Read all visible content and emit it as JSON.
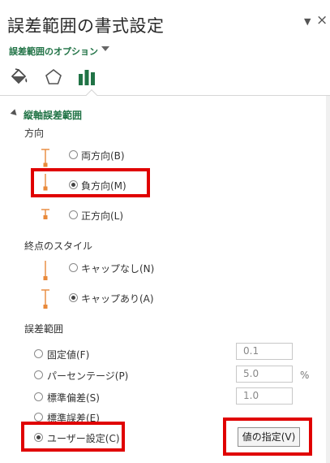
{
  "pane": {
    "title": "誤差範囲の書式設定",
    "pin_icon": "▼",
    "close_icon": "×",
    "options_label": "誤差範囲のオプション"
  },
  "tabs": [
    {
      "name": "fill-line",
      "icon": "paint-bucket-icon"
    },
    {
      "name": "effects",
      "icon": "pentagon-icon"
    },
    {
      "name": "options",
      "icon": "bar-chart-icon",
      "selected": true
    }
  ],
  "section": {
    "label": "縦軸誤差範囲"
  },
  "direction": {
    "label": "方向",
    "options": [
      {
        "label": "両方向(B)",
        "checked": false
      },
      {
        "label": "負方向(M)",
        "checked": true
      },
      {
        "label": "正方向(L)",
        "checked": false
      }
    ]
  },
  "end_style": {
    "label": "終点のスタイル",
    "options": [
      {
        "label": "キャップなし(N)",
        "checked": false
      },
      {
        "label": "キャップあり(A)",
        "checked": true
      }
    ]
  },
  "error_amount": {
    "label": "誤差範囲",
    "options": [
      {
        "label": "固定値(F)",
        "checked": false,
        "value": "0.1"
      },
      {
        "label": "パーセンテージ(P)",
        "checked": false,
        "value": "5.0",
        "unit": "%"
      },
      {
        "label": "標準偏差(S)",
        "checked": false,
        "value": "1.0"
      },
      {
        "label": "標準誤差(E)",
        "checked": false
      },
      {
        "label": "ユーザー設定(C)",
        "checked": true
      }
    ],
    "specify_button": "値の指定(V)"
  },
  "colors": {
    "accent": "#217346",
    "icon_orange": "#e8893a",
    "highlight": "#e00000"
  }
}
